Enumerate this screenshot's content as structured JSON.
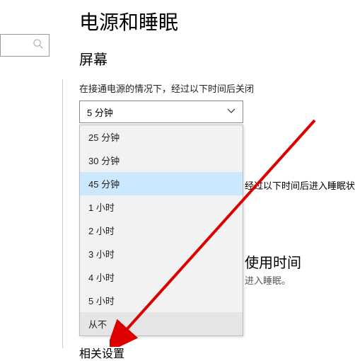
{
  "title": "电源和睡眠",
  "search": {
    "placeholder": ""
  },
  "screen": {
    "heading": "屏幕",
    "plugged_in_desc": "在接通电源的情况下，经过以下时间后关闭",
    "selected": "5 分钟"
  },
  "dropdown": {
    "items": [
      {
        "label": "25 分钟"
      },
      {
        "label": "30 分钟"
      },
      {
        "label": "45 分钟",
        "selected": true
      },
      {
        "label": "1 小时"
      },
      {
        "label": "2 小时"
      },
      {
        "label": "3 小时"
      },
      {
        "label": "4 小时"
      },
      {
        "label": "5 小时"
      },
      {
        "label": "从不",
        "hover": true
      }
    ]
  },
  "sleep": {
    "plugged_in_desc": "经过以下时间后进入睡眠状态"
  },
  "usage": {
    "heading": "使用时间",
    "desc": "进入睡眠。"
  },
  "related": {
    "heading": "相关设置"
  }
}
